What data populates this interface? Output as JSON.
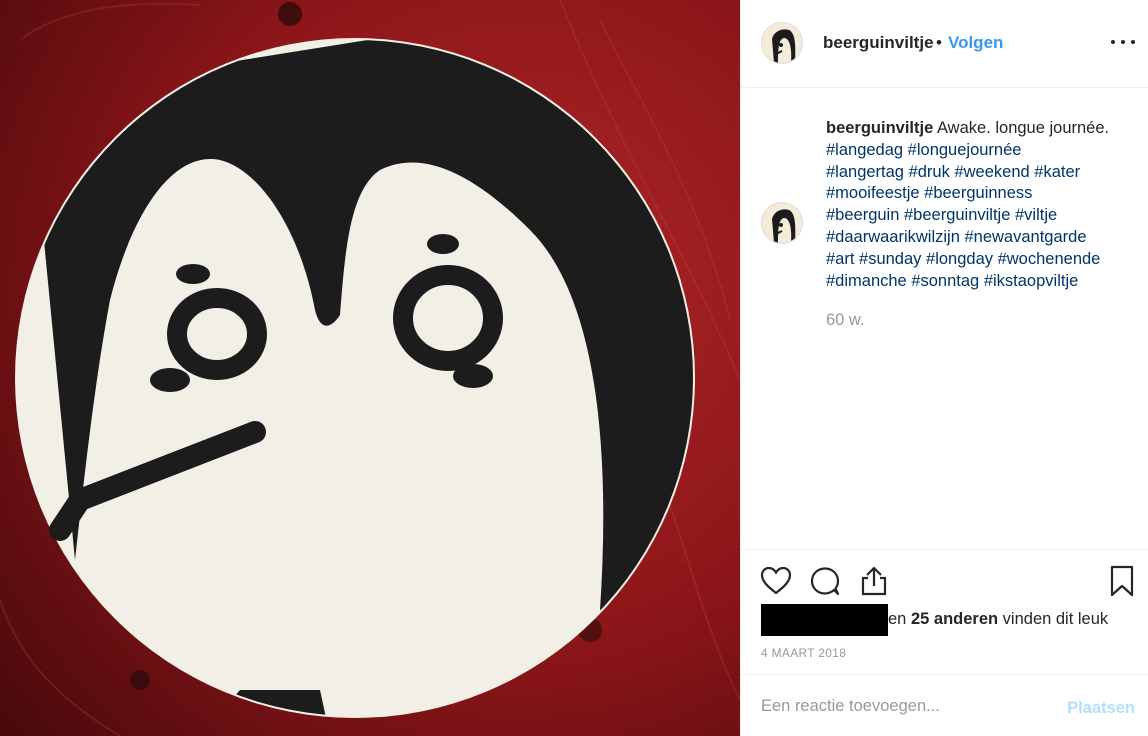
{
  "post": {
    "image_alt": "Penguin face drawn on a round beer coaster on a red wooden table",
    "colors": {
      "table_red": "#8b1a1a",
      "coaster_white": "#f2efe6",
      "ink_black": "#1c1c1c"
    }
  },
  "header": {
    "username": "beerguinviltje",
    "separator": "•",
    "follow_label": "Volgen",
    "more_icon": "ellipsis-icon"
  },
  "caption": {
    "username": "beerguinviltje",
    "text": "Awake. longue journée.",
    "hashtags": [
      "#langedag",
      "#longuejournée",
      "#langertag",
      "#druk",
      "#weekend",
      "#kater",
      "#mooifeestje",
      "#beerguinness",
      "#beerguin",
      "#beerguinviltje",
      "#viltje",
      "#daarwaarikwilzijn",
      "#newavantgarde",
      "#art",
      "#sunday",
      "#longday",
      "#wochenende",
      "#dimanche",
      "#sonntag",
      "#ikstaopviltje"
    ],
    "age": "60 w."
  },
  "actions": {
    "icons": [
      "heart-icon",
      "comment-icon",
      "share-icon",
      "bookmark-icon"
    ]
  },
  "likes": {
    "prefix": "en",
    "count_label": "25 anderen",
    "suffix": "vinden dit leuk"
  },
  "date": "4 MAART 2018",
  "comment": {
    "placeholder": "Een reactie toevoegen...",
    "post_label": "Plaatsen",
    "post_color": "#b2dffc"
  }
}
